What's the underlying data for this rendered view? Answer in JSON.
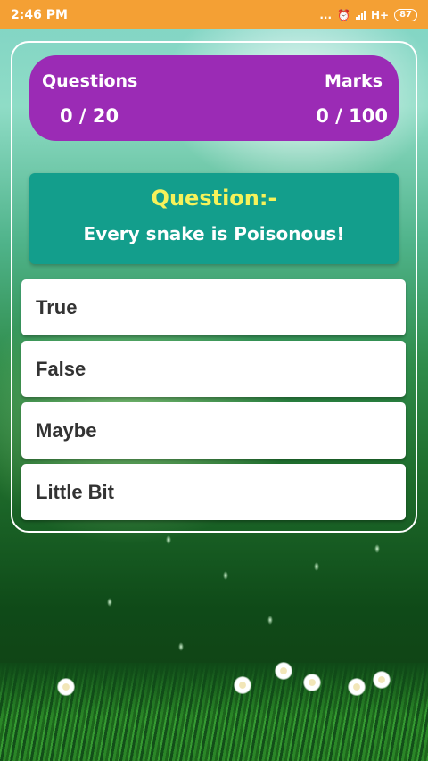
{
  "status_bar": {
    "time": "2:46 PM",
    "dots": "...",
    "network": "H+",
    "battery": "87"
  },
  "score": {
    "questions_label": "Questions",
    "questions_value": "0 / 20",
    "marks_label": "Marks",
    "marks_value": "0 / 100"
  },
  "question": {
    "title": "Question:-",
    "text": "Every snake is Poisonous!"
  },
  "options": [
    {
      "label": "True"
    },
    {
      "label": "False"
    },
    {
      "label": "Maybe"
    },
    {
      "label": "Little Bit"
    }
  ],
  "colors": {
    "status_bar": "#f4a034",
    "score_card": "#9b2bb5",
    "question_card": "#139e8c",
    "question_title": "#f6f25a"
  }
}
